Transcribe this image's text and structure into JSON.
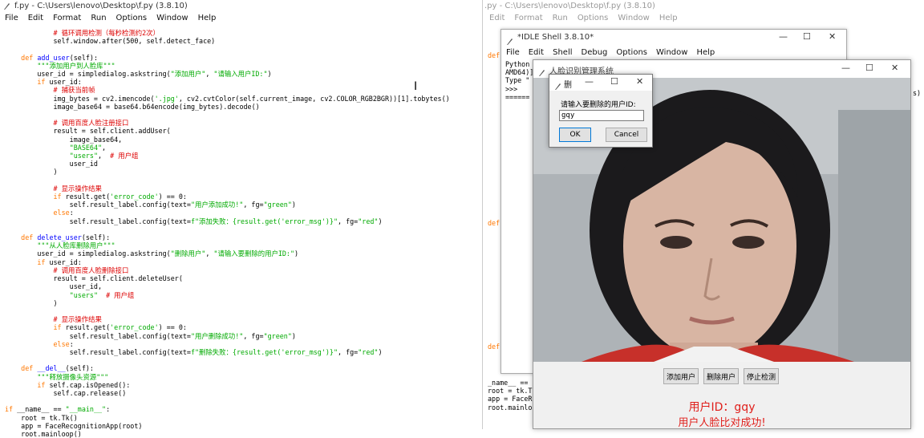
{
  "editor": {
    "title": "f.py - C:\\Users\\lenovo\\Desktop\\f.py (3.8.10)",
    "menu": [
      "File",
      "Edit",
      "Format",
      "Run",
      "Options",
      "Window",
      "Help"
    ]
  },
  "bg_editor": {
    "title": ".py - C:\\Users\\lenovo\\Desktop\\f.py (3.8.10)",
    "menu": [
      "Edit",
      "Format",
      "Run",
      "Options",
      "Window",
      "Help"
    ],
    "code_frag_1": "def",
    "code_frag_2": "def",
    "code_frag_3": "def",
    "bottom_lines": [
      "_name__ ==",
      "root = tk.T",
      "app = FaceR",
      "root.mainlo"
    ]
  },
  "shell": {
    "title": "*IDLE Shell 3.8.10*",
    "menu": [
      "File",
      "Edit",
      "Shell",
      "Debug",
      "Options",
      "Window",
      "Help"
    ],
    "lines": [
      "Python",
      "AMD64)]",
      "Type \"",
      ">>>",
      "======"
    ],
    "right_frag": "s)"
  },
  "face_app": {
    "title": "人脸识别管理系统",
    "buttons": {
      "add": "添加用户",
      "delete": "删除用户",
      "stop": "停止检测"
    },
    "user_id": "用户ID：gqy",
    "result": "用户人脸比对成功!"
  },
  "dialog": {
    "title": "删",
    "prompt": "请输入要删除的用户ID:",
    "input_value": "gqy",
    "ok": "OK",
    "cancel": "Cancel"
  },
  "colors": {
    "accent_red": "#e0201c",
    "title_blue": "#0b3d91"
  }
}
